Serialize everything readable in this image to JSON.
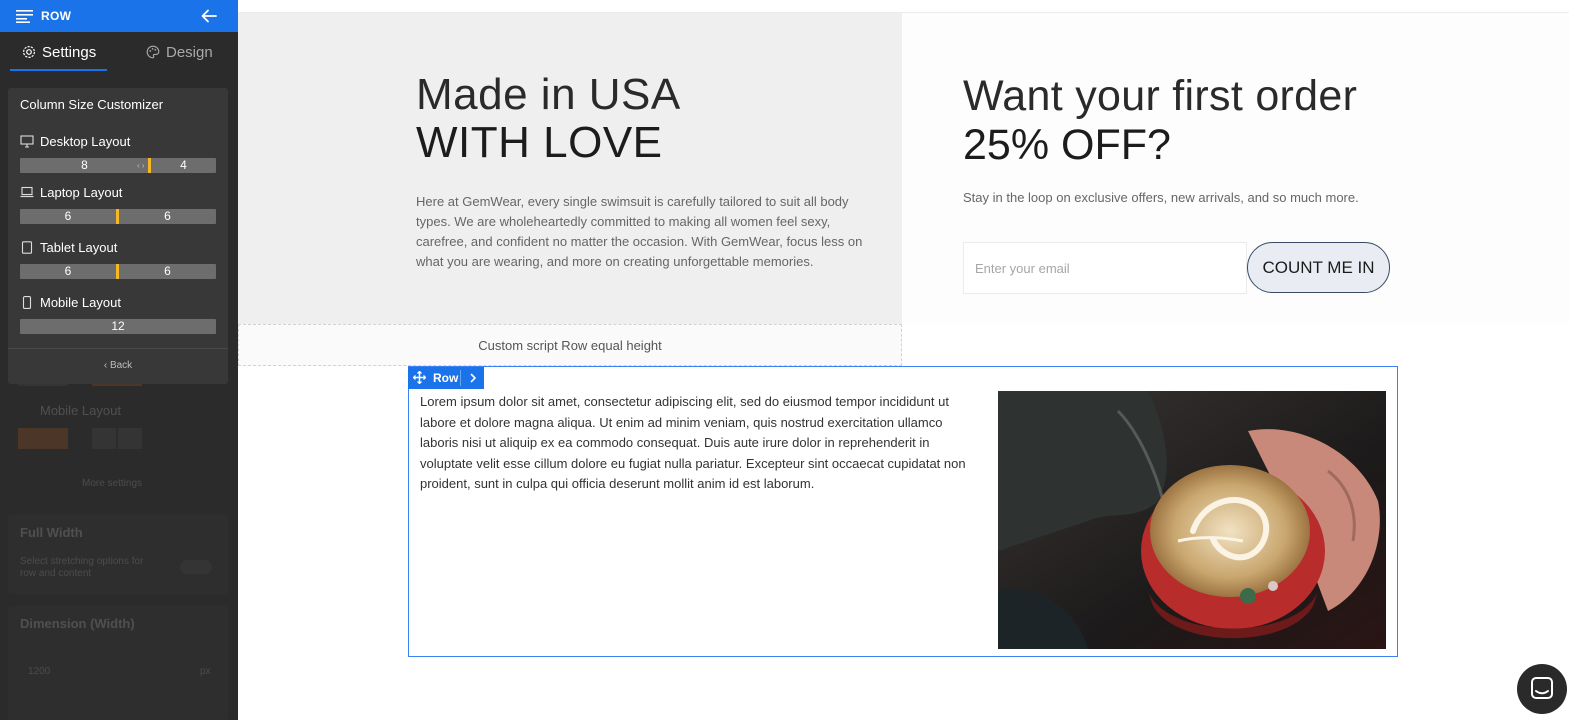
{
  "sidebar": {
    "title": "ROW",
    "tabs": [
      {
        "label": "Settings",
        "active": true
      },
      {
        "label": "Design",
        "active": false
      }
    ],
    "column_size_customizer": {
      "title": "Column Size Customizer",
      "layouts": [
        {
          "label": "Desktop Layout",
          "icon": "desktop-icon",
          "columns": [
            "8",
            "4"
          ]
        },
        {
          "label": "Laptop Layout",
          "icon": "laptop-icon",
          "columns": [
            "6",
            "6"
          ]
        },
        {
          "label": "Tablet Layout",
          "icon": "tablet-icon",
          "columns": [
            "6",
            "6"
          ]
        },
        {
          "label": "Mobile Layout",
          "icon": "mobile-icon",
          "columns": [
            "12"
          ]
        }
      ],
      "back_label": "Back"
    },
    "faded": {
      "mobile_layout_label": "Mobile Layout",
      "more_settings_label": "More settings",
      "full_width_label": "Full Width",
      "full_width_hint": "Select stretching options for row and content",
      "dimension_label": "Dimension (Width)",
      "dimension_value": "1200",
      "dimension_unit": "px"
    }
  },
  "canvas": {
    "left_heading_line1": "Made in USA",
    "left_heading_line2": "WITH LOVE",
    "left_body": "Here at GemWear, every single swimsuit is carefully tailored to suit all body types. We are wholeheartedly committed to making all women feel sexy, carefree, and confident no matter the occasion. With GemWear, focus less on what you are wearing, and more on creating unforgettable memories.",
    "right_heading_line1": "Want your first order",
    "right_heading_line2": "25% OFF?",
    "right_subtext": "Stay in the loop on exclusive offers, new arrivals, and so much more.",
    "email_placeholder": "Enter your email",
    "cta_label": "COUNT ME IN",
    "custom_script_label": "Custom script Row equal height",
    "row_toolbar_label": "Row",
    "lorem": "Lorem ipsum dolor sit amet, consectetur adipiscing elit, sed do eiusmod tempor incididunt ut labore et dolore magna aliqua. Ut enim ad minim veniam, quis nostrud exercitation ullamco laboris nisi ut aliquip ex ea commodo consequat. Duis aute irure dolor in reprehenderit in voluptate velit esse cillum dolore eu fugiat nulla pariatur. Excepteur sint occaecat cupidatat non proident, sunt in culpa qui officia deserunt mollit anim id est laborum.",
    "photo_subject": "latte-art-coffee-cup"
  },
  "colors": {
    "accent": "#1a73e8",
    "sidebar_bg": "#2b2b2b",
    "divider_handle": "#f4b825"
  }
}
